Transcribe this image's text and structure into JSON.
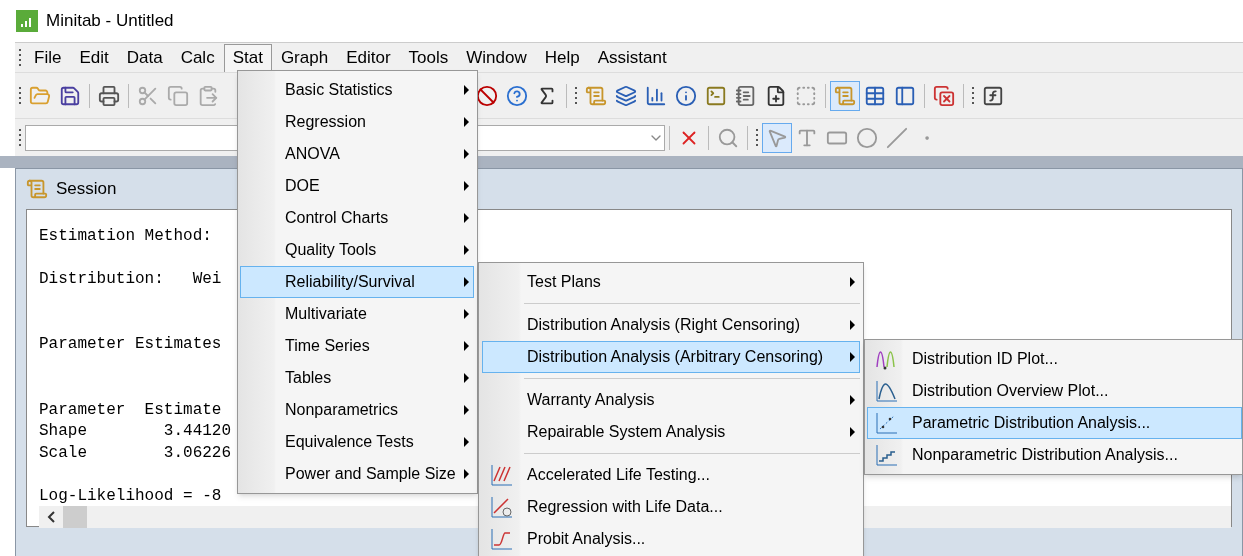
{
  "window": {
    "title": "Minitab - Untitled"
  },
  "menubar": [
    {
      "label": "File",
      "selected": false
    },
    {
      "label": "Edit",
      "selected": false
    },
    {
      "label": "Data",
      "selected": false
    },
    {
      "label": "Calc",
      "selected": false
    },
    {
      "label": "Stat",
      "selected": true
    },
    {
      "label": "Graph",
      "selected": false
    },
    {
      "label": "Editor",
      "selected": false
    },
    {
      "label": "Tools",
      "selected": false
    },
    {
      "label": "Window",
      "selected": false
    },
    {
      "label": "Help",
      "selected": false
    },
    {
      "label": "Assistant",
      "selected": false
    }
  ],
  "session": {
    "title": "Session",
    "blocks": [
      [
        "Estimation Method:"
      ],
      [
        "Distribution:   Wei"
      ],
      [
        "Parameter Estimates"
      ],
      [
        "Parameter  Estimate",
        "Shape        3.44120",
        "Scale        3.06226"
      ],
      [
        "Log-Likelihood = -8"
      ]
    ]
  },
  "stat_menu": [
    {
      "label": "Basic Statistics",
      "selected": false
    },
    {
      "label": "Regression",
      "selected": false
    },
    {
      "label": "ANOVA",
      "selected": false
    },
    {
      "label": "DOE",
      "selected": false
    },
    {
      "label": "Control Charts",
      "selected": false
    },
    {
      "label": "Quality Tools",
      "selected": false
    },
    {
      "label": "Reliability/Survival",
      "selected": true
    },
    {
      "label": "Multivariate",
      "selected": false
    },
    {
      "label": "Time Series",
      "selected": false
    },
    {
      "label": "Tables",
      "selected": false
    },
    {
      "label": "Nonparametrics",
      "selected": false
    },
    {
      "label": "Equivalence Tests",
      "selected": false
    },
    {
      "label": "Power and Sample Size",
      "selected": false
    }
  ],
  "reliability_menu": [
    [
      {
        "label": "Test Plans",
        "kind": "submenu",
        "selected": false
      }
    ],
    [
      {
        "label": "Distribution Analysis (Right Censoring)",
        "kind": "submenu",
        "selected": false
      },
      {
        "label": "Distribution Analysis (Arbitrary Censoring)",
        "kind": "submenu",
        "selected": true
      }
    ],
    [
      {
        "label": "Warranty Analysis",
        "kind": "submenu",
        "selected": false
      },
      {
        "label": "Repairable System Analysis",
        "kind": "submenu",
        "selected": false
      }
    ],
    [
      {
        "label": "Accelerated Life Testing...",
        "kind": "command",
        "selected": false
      },
      {
        "label": "Regression with Life Data...",
        "kind": "command",
        "selected": false
      },
      {
        "label": "Probit Analysis...",
        "kind": "command",
        "selected": false
      }
    ]
  ],
  "arbitrary_menu": [
    {
      "label": "Distribution ID Plot...",
      "selected": false
    },
    {
      "label": "Distribution Overview Plot...",
      "selected": false
    },
    {
      "label": "Parametric Distribution Analysis...",
      "selected": true
    },
    {
      "label": "Nonparametric Distribution Analysis...",
      "selected": false
    }
  ]
}
